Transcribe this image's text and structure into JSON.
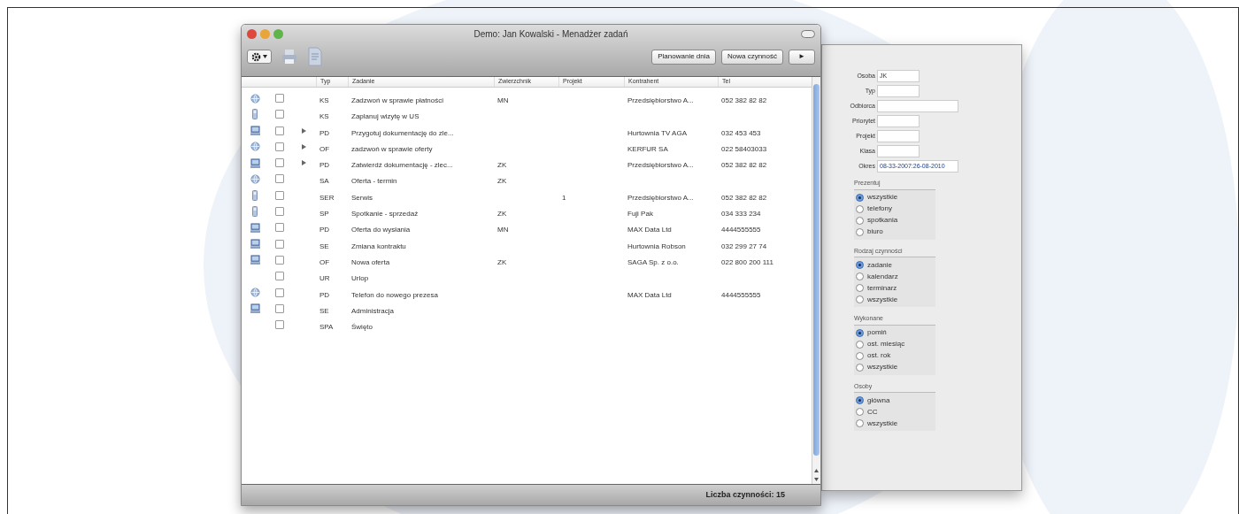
{
  "window": {
    "title": "Demo: Jan Kowalski - Menadżer zadań"
  },
  "toolbar": {
    "buttons": [
      {
        "label": "Planowanie dnia"
      },
      {
        "label": "Nowa czynność"
      },
      {
        "label": "►"
      }
    ]
  },
  "table": {
    "columns": [
      "Typ",
      "Zadanie",
      "Zwierzchnik",
      "Projekt",
      "Kontrahent",
      "Tel"
    ],
    "rows": [
      {
        "kind": "globe",
        "checked": false,
        "expandable": false,
        "cells": [
          "KS",
          "Zadzwoń w sprawie płatności",
          "MN",
          "",
          "Przedsiębiorstwo A...",
          "052 382 82 82"
        ]
      },
      {
        "kind": "phone",
        "checked": false,
        "expandable": false,
        "cells": [
          "KS",
          "Zaplanuj wizytę w US",
          "",
          "",
          "",
          ""
        ]
      },
      {
        "kind": "computer",
        "checked": false,
        "expandable": true,
        "cells": [
          "PD",
          "Przygotuj dokumentację do zle...",
          "",
          "",
          "Hurtownia TV AGA",
          "032 453 453"
        ]
      },
      {
        "kind": "globe",
        "checked": false,
        "expandable": true,
        "cells": [
          "OF",
          "zadzwoń w sprawie oferty",
          "",
          "",
          "KERFUR SA",
          "022 58403033"
        ]
      },
      {
        "kind": "computer",
        "checked": false,
        "expandable": true,
        "cells": [
          "PD",
          "Zatwierdź dokumentację - zlec...",
          "ZK",
          "",
          "Przedsiębiorstwo A...",
          "052 382 82 82"
        ]
      },
      {
        "kind": "globe",
        "checked": false,
        "expandable": false,
        "cells": [
          "SA",
          "Oferta - termin",
          "ZK",
          "",
          "",
          ""
        ]
      },
      {
        "kind": "phone",
        "checked": false,
        "expandable": false,
        "cells": [
          "SER",
          "Serwis",
          "",
          "1",
          "Przedsiębiorstwo A...",
          "052 382 82 82"
        ]
      },
      {
        "kind": "phone",
        "checked": false,
        "expandable": false,
        "cells": [
          "SP",
          "Spotkanie - sprzedaż",
          "ZK",
          "",
          "Fuji Pak",
          "034 333 234"
        ]
      },
      {
        "kind": "computer",
        "checked": false,
        "expandable": false,
        "cells": [
          "PD",
          "Oferta do wysłania",
          "MN",
          "",
          "MAX Data Ltd",
          "4444555555"
        ]
      },
      {
        "kind": "computer",
        "checked": false,
        "expandable": false,
        "cells": [
          "SE",
          "Zmiana kontraktu",
          "",
          "",
          "Hurtownia Robson",
          "032 299 27 74"
        ]
      },
      {
        "kind": "computer",
        "checked": false,
        "expandable": false,
        "cells": [
          "OF",
          "Nowa oferta",
          "ZK",
          "",
          "SAGA Sp. z o.o.",
          "022 800 200 111"
        ]
      },
      {
        "kind": "none",
        "checked": false,
        "expandable": false,
        "cells": [
          "UR",
          "Urlop",
          "",
          "",
          "",
          ""
        ]
      },
      {
        "kind": "globe",
        "checked": false,
        "expandable": false,
        "cells": [
          "PD",
          "Telefon do nowego prezesa",
          "",
          "",
          "MAX Data Ltd",
          "4444555555"
        ]
      },
      {
        "kind": "computer",
        "checked": false,
        "expandable": false,
        "cells": [
          "SE",
          "Administracja",
          "",
          "",
          "",
          ""
        ]
      },
      {
        "kind": "none",
        "checked": false,
        "expandable": false,
        "cells": [
          "SPA",
          "Święto",
          "",
          "",
          "",
          ""
        ]
      }
    ]
  },
  "status_bar": "Liczba czynności: 15",
  "filters": {
    "fields": [
      {
        "label": "Osoba",
        "value": "JK",
        "wide": false
      },
      {
        "label": "Typ",
        "wide": false
      },
      {
        "label": "Odbiorca",
        "wide": true
      },
      {
        "label": "Priorytet",
        "wide": false
      },
      {
        "label": "Projekt",
        "wide": false
      },
      {
        "label": "Klasa",
        "wide": false
      },
      {
        "label": "Okres",
        "value": "08-33-2007:26-08-2010",
        "wide": true
      }
    ],
    "groups": [
      {
        "title": "Prezentuj",
        "options": [
          {
            "label": "wszystkie",
            "selected": true
          },
          {
            "label": "telefony",
            "selected": false
          },
          {
            "label": "spotkania",
            "selected": false
          },
          {
            "label": "biuro",
            "selected": false
          }
        ]
      },
      {
        "title": "Rodzaj czynności",
        "options": [
          {
            "label": "zadanie",
            "selected": true
          },
          {
            "label": "kalendarz",
            "selected": false
          },
          {
            "label": "terminarz",
            "selected": false
          },
          {
            "label": "wszystkie",
            "selected": false
          }
        ]
      },
      {
        "title": "Wykonane",
        "options": [
          {
            "label": "pomiń",
            "selected": true
          },
          {
            "label": "ost. miesiąc",
            "selected": false
          },
          {
            "label": "ost. rok",
            "selected": false
          },
          {
            "label": "wszystkie",
            "selected": false
          }
        ]
      },
      {
        "title": "Osoby",
        "options": [
          {
            "label": "główna",
            "selected": true
          },
          {
            "label": "CC",
            "selected": false
          },
          {
            "label": "wszystkie",
            "selected": false
          }
        ]
      }
    ]
  }
}
